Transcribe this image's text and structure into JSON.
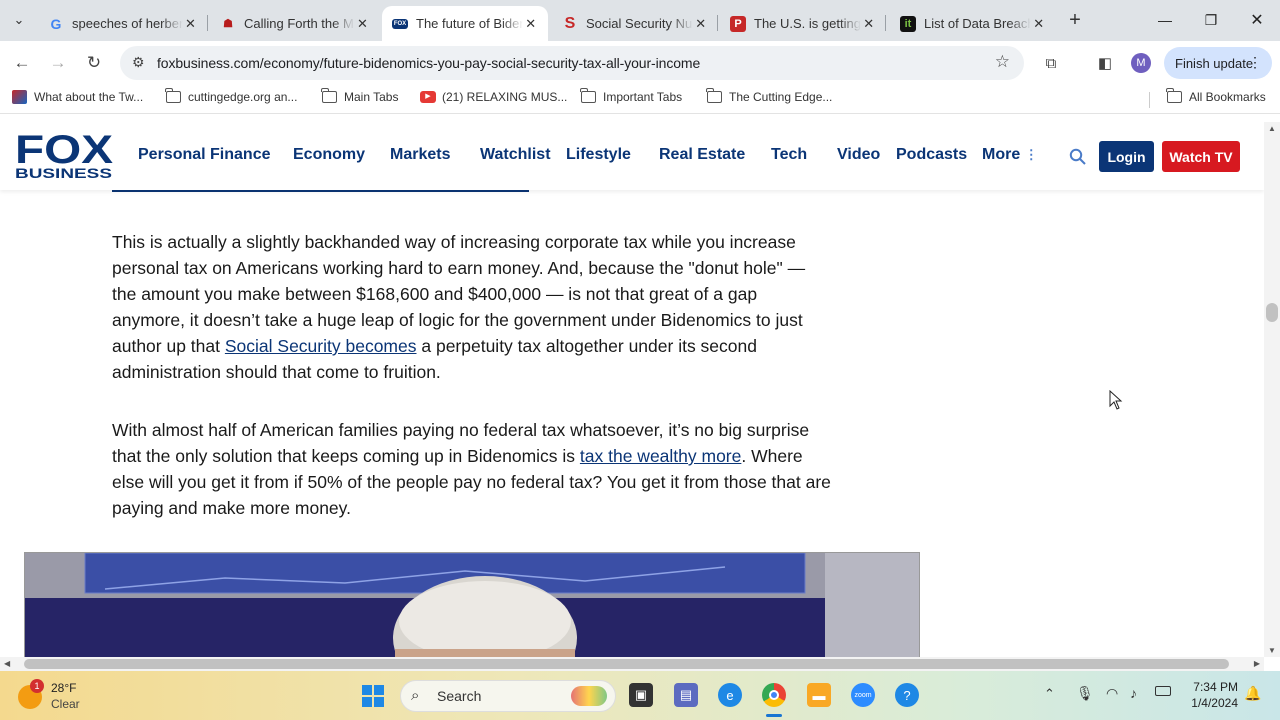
{
  "tabs": [
    {
      "title": "speeches of herbert",
      "favicon": "G",
      "color": "#4285f4",
      "bg": "transparent",
      "active": false
    },
    {
      "title": "Calling Forth the M",
      "favicon": "☗",
      "color": "#b71c1c",
      "bg": "transparent",
      "active": false
    },
    {
      "title": "The future of Biden",
      "favicon": "FOX",
      "color": "#0b3576",
      "bg": "#ffffff",
      "active": true
    },
    {
      "title": "Social Security Nu",
      "favicon": "S",
      "color": "#c62828",
      "bg": "transparent",
      "active": false
    },
    {
      "title": "The U.S. is getting",
      "favicon": "P",
      "color": "#ffffff",
      "bg": "#c62828",
      "active": false
    },
    {
      "title": "List of Data Breach",
      "favicon": "it",
      "color": "#7bc043",
      "bg": "#111111",
      "active": false
    }
  ],
  "address_bar": {
    "url": "foxbusiness.com/economy/future-bidenomics-you-pay-social-security-tax-all-your-income"
  },
  "profile_initial": "M",
  "finish_update_label": "Finish update",
  "bookmarks": [
    {
      "label": "What about the Tw...",
      "icon": "twitter-photo-icon"
    },
    {
      "label": "cuttingedge.org an...",
      "icon": "folder-icon"
    },
    {
      "label": "Main Tabs",
      "icon": "folder-icon"
    },
    {
      "label": "(21) RELAXING MUS...",
      "icon": "youtube-icon"
    },
    {
      "label": "Important Tabs",
      "icon": "folder-icon"
    },
    {
      "label": "The Cutting Edge...",
      "icon": "folder-icon"
    }
  ],
  "all_bookmarks_label": "All Bookmarks",
  "site": {
    "logo_top": "FOX",
    "logo_bottom": "BUSINESS",
    "nav": [
      "Personal Finance",
      "Economy",
      "Markets",
      "Watchlist",
      "Lifestyle",
      "Real Estate",
      "Tech",
      "Video",
      "Podcasts",
      "More"
    ],
    "login_label": "Login",
    "watch_label": "Watch TV"
  },
  "article": {
    "p1_a": "This is actually a slightly backhanded way of increasing corporate tax while you increase personal tax on Americans working hard to earn money. And, because the \"donut hole\" — the amount you make between $168,600 and $400,000 — is not that great of a gap anymore, it doesn’t take a huge leap of logic for the government under Bidenomics to just author up that ",
    "p1_link": "Social Security becomes",
    "p1_b": " a perpetuity tax altogether under its second administration should that come to fruition.",
    "p2_a": "With almost half of American families paying no federal tax whatsoever, it’s no big surprise that the only solution that keeps coming up in Bidenomics is ",
    "p2_link": "tax the wealthy more",
    "p2_b": ". Where else will you get it from if 50% of the people pay no federal tax? You get it from those that are paying and make more money."
  },
  "taskbar": {
    "weather_temp": "28°F",
    "weather_cond": "Clear",
    "weather_badge": "1",
    "search_placeholder": "Search",
    "time": "7:34 PM",
    "date": "1/4/2024"
  },
  "colors": {
    "fox_blue": "#0b3576",
    "fox_red": "#d71920",
    "chrome_update": "#d3e3fd"
  }
}
